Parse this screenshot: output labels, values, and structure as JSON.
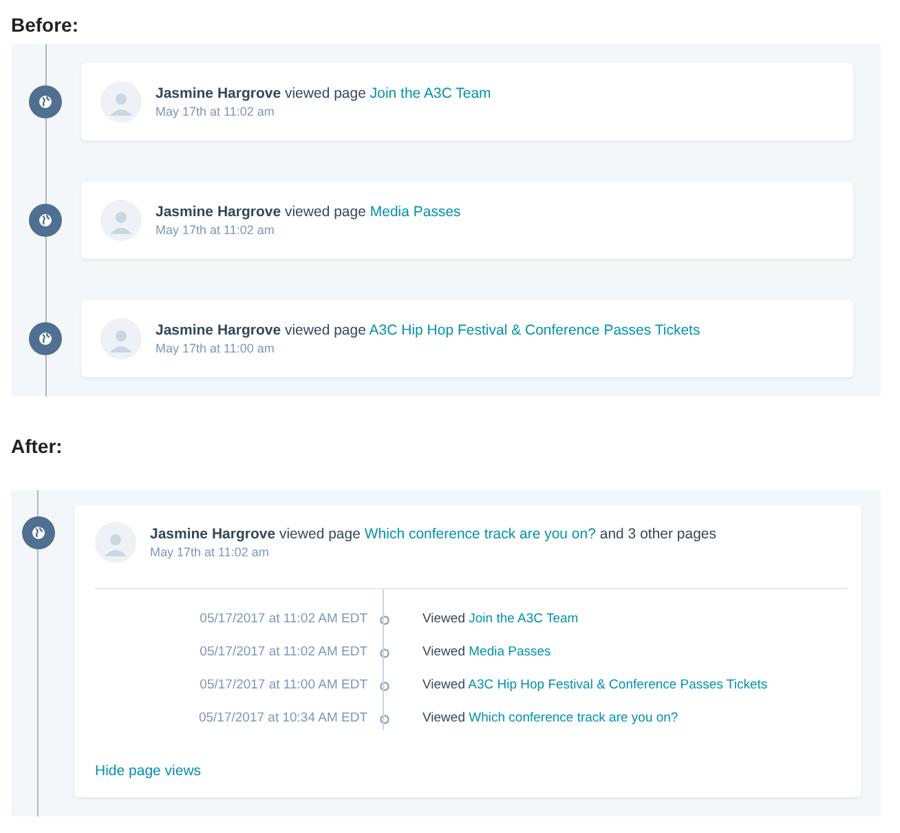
{
  "before": {
    "heading": "Before:",
    "events": [
      {
        "actor": "Jasmine Hargrove",
        "action": "viewed page",
        "page": "Join the A3C Team",
        "time": "May 17th at 11:02 am"
      },
      {
        "actor": "Jasmine Hargrove",
        "action": "viewed page",
        "page": "Media Passes",
        "time": "May 17th at 11:02 am"
      },
      {
        "actor": "Jasmine Hargrove",
        "action": "viewed page",
        "page": "A3C Hip Hop Festival & Conference Passes Tickets",
        "time": "May 17th at 11:00 am"
      }
    ]
  },
  "after": {
    "heading": "After:",
    "event": {
      "actor": "Jasmine Hargrove",
      "action": "viewed page",
      "page": "Which conference track are you on?",
      "suffix": "and 3 other pages",
      "time": "May 17th at 11:02 am",
      "views": [
        {
          "time": "05/17/2017 at 11:02 AM EDT",
          "verb": "Viewed",
          "page": "Join the A3C Team"
        },
        {
          "time": "05/17/2017 at 11:02 AM EDT",
          "verb": "Viewed",
          "page": "Media Passes"
        },
        {
          "time": "05/17/2017 at 11:00 AM EDT",
          "verb": "Viewed",
          "page": "A3C Hip Hop Festival & Conference Passes Tickets"
        },
        {
          "time": "05/17/2017 at 10:34 AM EDT",
          "verb": "Viewed",
          "page": "Which conference track are you on?"
        }
      ],
      "toggle": "Hide page views"
    }
  }
}
